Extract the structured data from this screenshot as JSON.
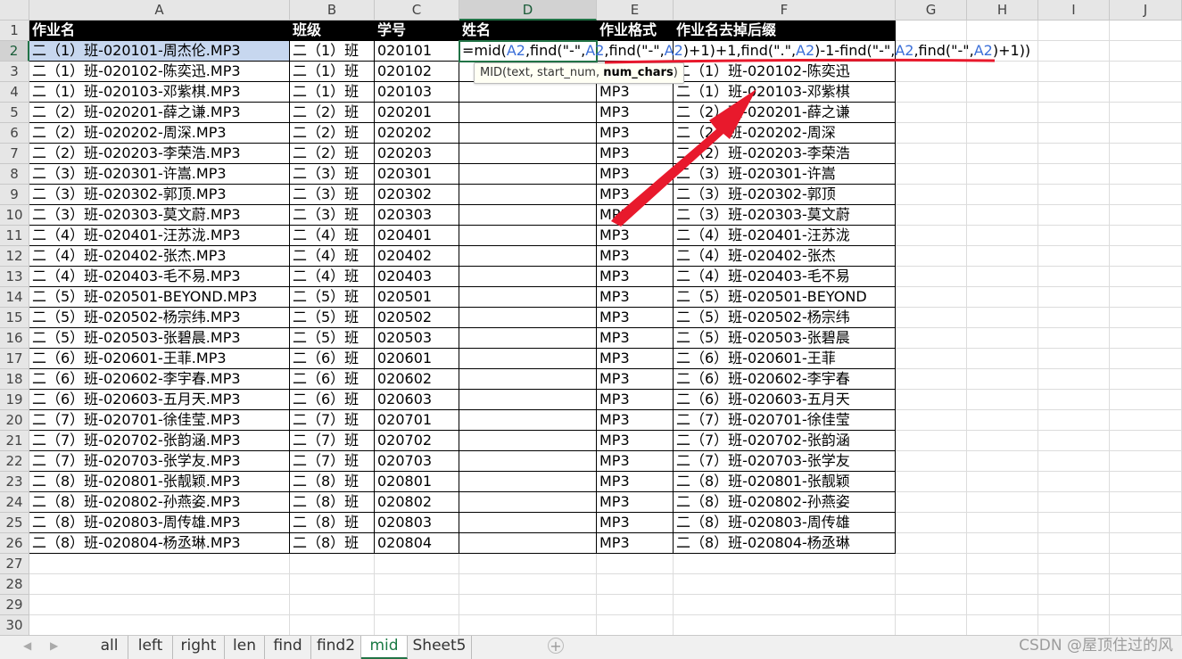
{
  "sheet": {
    "columns": [
      "A",
      "B",
      "C",
      "D",
      "E",
      "F",
      "G",
      "H",
      "I",
      "J"
    ],
    "selected_column": "D",
    "active_row": "2",
    "rows": [
      [
        "作业名",
        "班级",
        "学号",
        "姓名",
        "作业格式",
        "作业名去掉后缀"
      ],
      [
        "二（1）班-020101-周杰伦.MP3",
        "二（1）班",
        "020101",
        "",
        "",
        ""
      ],
      [
        "二（1）班-020102-陈奕迅.MP3",
        "二（1）班",
        "020102",
        "",
        "",
        "二（1）班-020102-陈奕迅"
      ],
      [
        "二（1）班-020103-邓紫棋.MP3",
        "二（1）班",
        "020103",
        "",
        "MP3",
        "二（1）班-020103-邓紫棋"
      ],
      [
        "二（2）班-020201-薛之谦.MP3",
        "二（2）班",
        "020201",
        "",
        "MP3",
        "二（2）班-020201-薛之谦"
      ],
      [
        "二（2）班-020202-周深.MP3",
        "二（2）班",
        "020202",
        "",
        "MP3",
        "二（2）班-020202-周深"
      ],
      [
        "二（2）班-020203-李荣浩.MP3",
        "二（2）班",
        "020203",
        "",
        "MP3",
        "二（2）班-020203-李荣浩"
      ],
      [
        "二（3）班-020301-许嵩.MP3",
        "二（3）班",
        "020301",
        "",
        "MP3",
        "二（3）班-020301-许嵩"
      ],
      [
        "二（3）班-020302-郭顶.MP3",
        "二（3）班",
        "020302",
        "",
        "MP3",
        "二（3）班-020302-郭顶"
      ],
      [
        "二（3）班-020303-莫文蔚.MP3",
        "二（3）班",
        "020303",
        "",
        "MP3",
        "二（3）班-020303-莫文蔚"
      ],
      [
        "二（4）班-020401-汪苏泷.MP3",
        "二（4）班",
        "020401",
        "",
        "MP3",
        "二（4）班-020401-汪苏泷"
      ],
      [
        "二（4）班-020402-张杰.MP3",
        "二（4）班",
        "020402",
        "",
        "MP3",
        "二（4）班-020402-张杰"
      ],
      [
        "二（4）班-020403-毛不易.MP3",
        "二（4）班",
        "020403",
        "",
        "MP3",
        "二（4）班-020403-毛不易"
      ],
      [
        "二（5）班-020501-BEYOND.MP3",
        "二（5）班",
        "020501",
        "",
        "MP3",
        "二（5）班-020501-BEYOND"
      ],
      [
        "二（5）班-020502-杨宗纬.MP3",
        "二（5）班",
        "020502",
        "",
        "MP3",
        "二（5）班-020502-杨宗纬"
      ],
      [
        "二（5）班-020503-张碧晨.MP3",
        "二（5）班",
        "020503",
        "",
        "MP3",
        "二（5）班-020503-张碧晨"
      ],
      [
        "二（6）班-020601-王菲.MP3",
        "二（6）班",
        "020601",
        "",
        "MP3",
        "二（6）班-020601-王菲"
      ],
      [
        "二（6）班-020602-李宇春.MP3",
        "二（6）班",
        "020602",
        "",
        "MP3",
        "二（6）班-020602-李宇春"
      ],
      [
        "二（6）班-020603-五月天.MP3",
        "二（6）班",
        "020603",
        "",
        "MP3",
        "二（6）班-020603-五月天"
      ],
      [
        "二（7）班-020701-徐佳莹.MP3",
        "二（7）班",
        "020701",
        "",
        "MP3",
        "二（7）班-020701-徐佳莹"
      ],
      [
        "二（7）班-020702-张韵涵.MP3",
        "二（7）班",
        "020702",
        "",
        "MP3",
        "二（7）班-020702-张韵涵"
      ],
      [
        "二（7）班-020703-张学友.MP3",
        "二（7）班",
        "020703",
        "",
        "MP3",
        "二（7）班-020703-张学友"
      ],
      [
        "二（8）班-020801-张靓颖.MP3",
        "二（8）班",
        "020801",
        "",
        "MP3",
        "二（8）班-020801-张靓颖"
      ],
      [
        "二（8）班-020802-孙燕姿.MP3",
        "二（8）班",
        "020802",
        "",
        "MP3",
        "二（8）班-020802-孙燕姿"
      ],
      [
        "二（8）班-020803-周传雄.MP3",
        "二（8）班",
        "020803",
        "",
        "MP3",
        "二（8）班-020803-周传雄"
      ],
      [
        "二（8）班-020804-杨丞琳.MP3",
        "二（8）班",
        "020804",
        "",
        "MP3",
        "二（8）班-020804-杨丞琳"
      ],
      [
        "",
        "",
        "",
        "",
        "",
        ""
      ],
      [
        "",
        "",
        "",
        "",
        "",
        ""
      ],
      [
        "",
        "",
        "",
        "",
        "",
        ""
      ],
      [
        "",
        "",
        "",
        "",
        "",
        ""
      ]
    ]
  },
  "formula": {
    "parts": [
      {
        "t": "=mid(",
        "c": "plain"
      },
      {
        "t": "A2",
        "c": "ref"
      },
      {
        "t": ",find(\"-\",",
        "c": "plain"
      },
      {
        "t": "A2",
        "c": "ref"
      },
      {
        "t": ",find(\"-\",",
        "c": "plain"
      },
      {
        "t": "A2",
        "c": "ref"
      },
      {
        "t": ")+1)+1,find(\".\",",
        "c": "plain"
      },
      {
        "t": "A2",
        "c": "ref"
      },
      {
        "t": ")-1-find(\"-\",",
        "c": "plain"
      },
      {
        "t": "A2",
        "c": "ref"
      },
      {
        "t": ",find(\"-\",",
        "c": "plain"
      },
      {
        "t": "A2",
        "c": "ref"
      },
      {
        "t": ")+1))",
        "c": "plain"
      }
    ]
  },
  "tooltip": {
    "prefix": "MID(text, start_num, ",
    "bold": "num_chars",
    "suffix": ")"
  },
  "tabs": [
    "all",
    "left",
    "right",
    "len",
    "find",
    "find2",
    "mid",
    "Sheet5"
  ],
  "active_tab": "mid",
  "watermark": "CSDN @屋顶住过的风",
  "colors": {
    "accent": "#217346",
    "annotation": "#e8192c",
    "ref": "#3b6fd8"
  }
}
